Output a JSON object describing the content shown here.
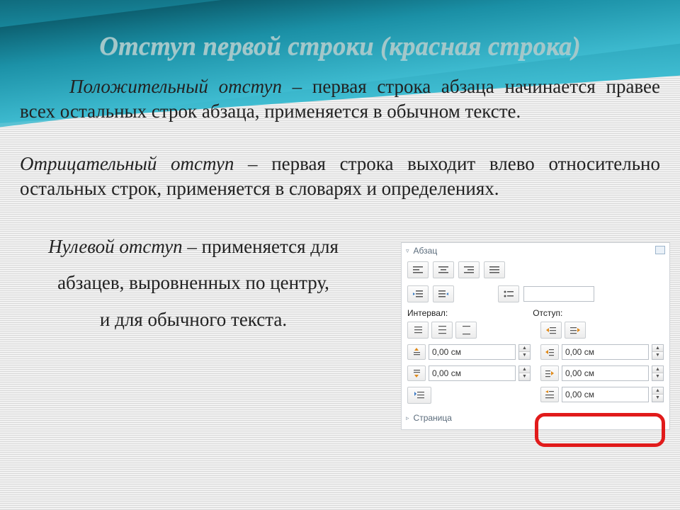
{
  "title": "Отступ первой строки (красная строка)",
  "p1_lead": "Положительный отступ",
  "p1_rest": " – первая строка абзаца начинается правее всех остальных строк абзаца, применяется в обычном тексте.",
  "p2_lead": "Отрицательный отступ",
  "p2_rest": " – первая строка выходит влево относительно остальных строк, применяется в словарях и определениях.",
  "p3_lead": "Нулевой отступ",
  "p3_rest1": " – применяется для",
  "p3_line2": "абзацев, выровненных по центру,",
  "p3_line3": "и для обычного текста.",
  "panel": {
    "sect_para": "Абзац",
    "sect_page": "Страница",
    "lbl_interval": "Интервал:",
    "lbl_indent": "Отступ:",
    "val_zero": "0,00 см"
  }
}
